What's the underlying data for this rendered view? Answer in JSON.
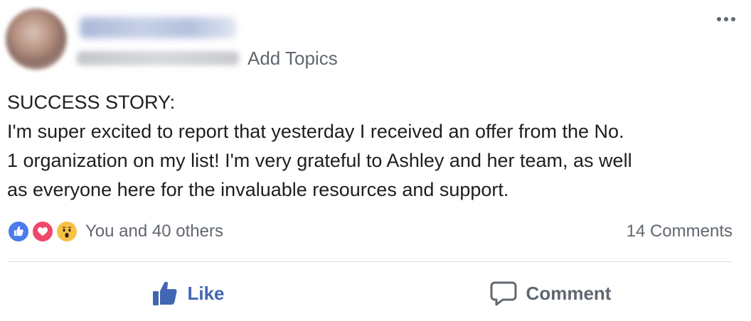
{
  "post": {
    "meta": {
      "add_topics_label": "Add Topics"
    },
    "text_lines": [
      "SUCCESS STORY:",
      "I'm super excited to report that yesterday I received an offer from the No.",
      "1 organization on my list! I'm very grateful to Ashley and her team, as well",
      "as everyone here for the invaluable resources and support."
    ],
    "reactions": {
      "types": [
        "like",
        "love",
        "wow"
      ],
      "summary": "You and 40 others"
    },
    "comments_count_label": "14 Comments",
    "actions": {
      "like_label": "Like",
      "comment_label": "Comment"
    },
    "colors": {
      "brand_blue": "#4267b2",
      "secondary_text": "#606770",
      "like_reaction": "#4b7bec",
      "love_reaction": "#f0476a",
      "wow_reaction": "#f7c244"
    },
    "icons": {
      "more": "more-horizontal-icon",
      "like": "thumbs-up-icon",
      "comment": "comment-bubble-icon"
    }
  }
}
